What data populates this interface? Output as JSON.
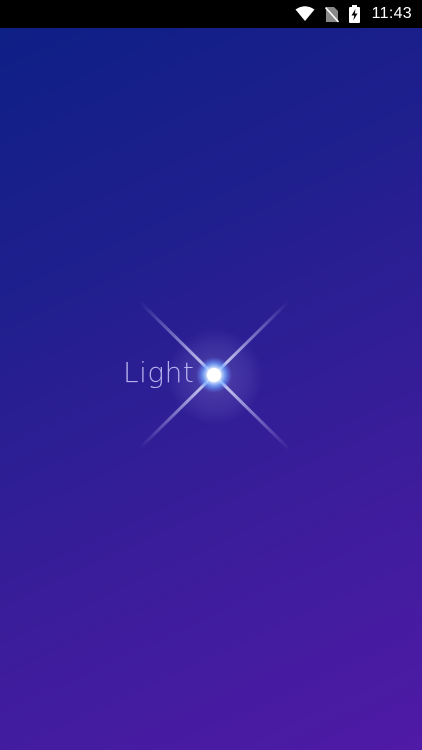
{
  "status_bar": {
    "time": "11:43",
    "icons": [
      "wifi-icon",
      "no-sim-icon",
      "battery-charging-icon"
    ]
  },
  "splash": {
    "logo_text": "Light",
    "colors": {
      "gradient_start": "#0e1f86",
      "gradient_end": "#4f1aa6",
      "logo_text": "#d6d0ff",
      "flare": "#cfe0ff"
    }
  }
}
